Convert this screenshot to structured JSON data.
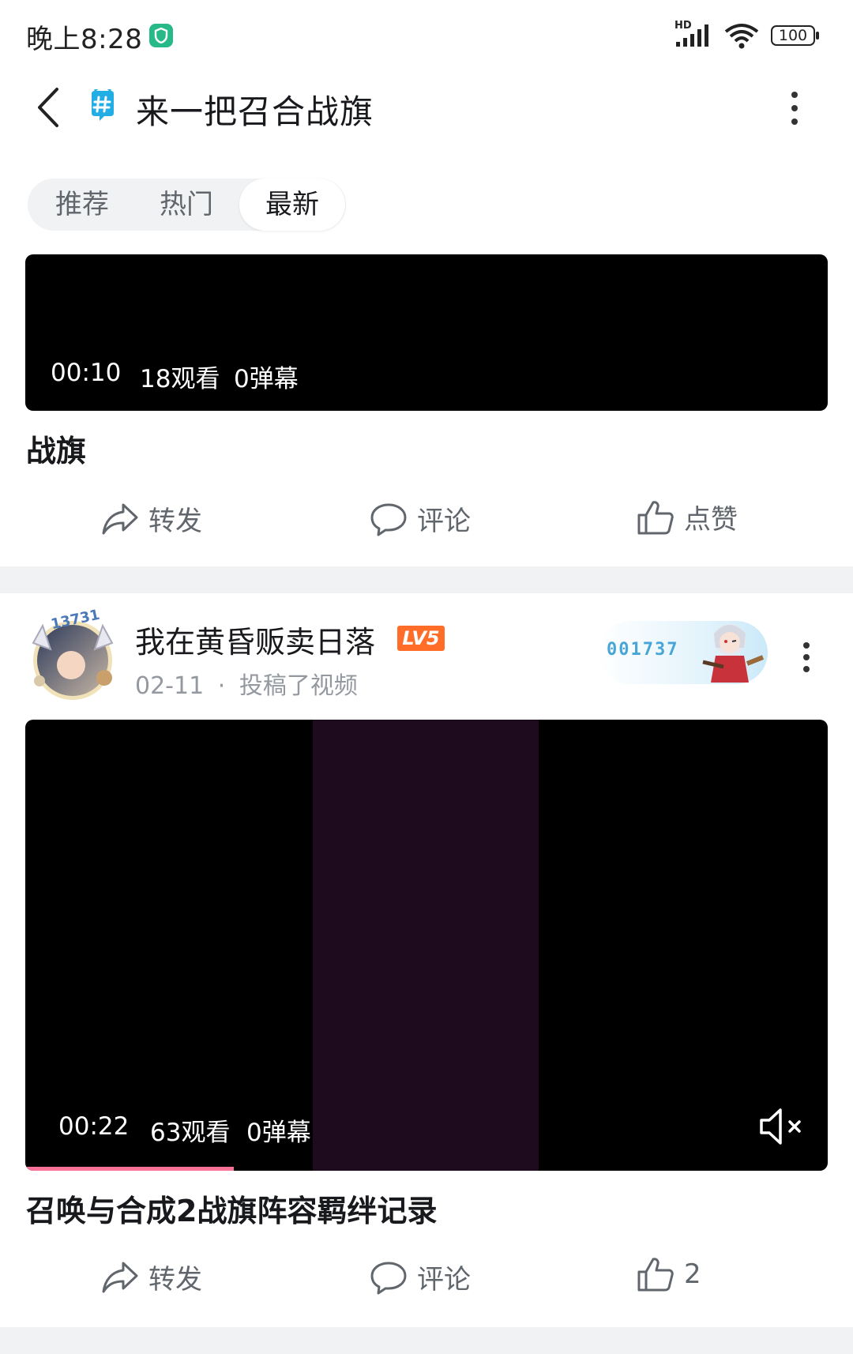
{
  "status_bar": {
    "time": "晚上8:28",
    "battery": "100",
    "network": "HD"
  },
  "header": {
    "title": "来一把召合战旗"
  },
  "tabs": [
    {
      "label": "推荐",
      "active": false
    },
    {
      "label": "热门",
      "active": false
    },
    {
      "label": "最新",
      "active": true
    }
  ],
  "posts": [
    {
      "video": {
        "duration": "00:10",
        "views": "18观看",
        "danmaku": "0弹幕"
      },
      "title": "战旗",
      "actions": {
        "share": "转发",
        "comment": "评论",
        "like": "点赞"
      }
    },
    {
      "author": {
        "name": "我在黄昏贩卖日落",
        "level": "LV5",
        "date": "02-11",
        "separator": "·",
        "action": "投稿了视频",
        "fan_number": "001737",
        "avatar_badge": "13731"
      },
      "video": {
        "duration": "00:22",
        "views": "63观看",
        "danmaku": "0弹幕",
        "progress": 0.26,
        "muted": true
      },
      "title": "召唤与合成2战旗阵容羁绊记录",
      "actions": {
        "share": "转发",
        "comment": "评论",
        "like": "2"
      }
    }
  ],
  "colors": {
    "accent_pink": "#fb7299",
    "level_orange": "#ff6d28",
    "topic_blue": "#23ade5",
    "divider": "#f1f2f3"
  }
}
